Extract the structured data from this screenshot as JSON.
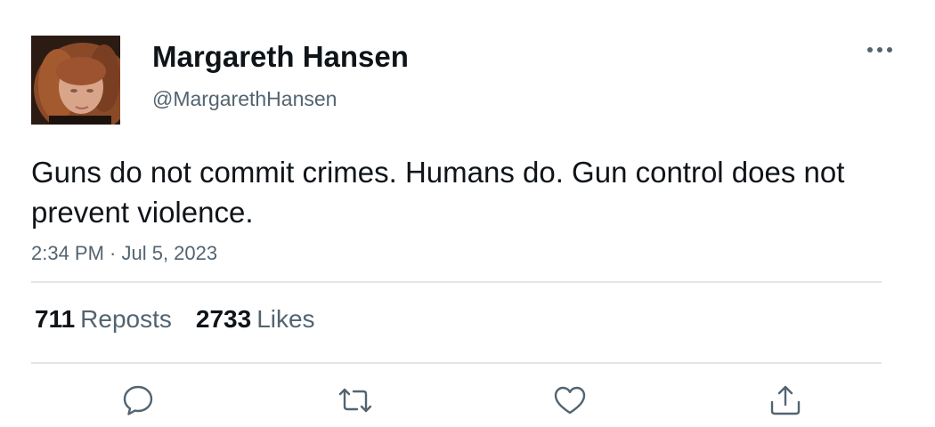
{
  "tweet": {
    "author": {
      "display_name": "Margareth Hansen",
      "handle": "@MargarethHansen"
    },
    "text": "Guns do not commit crimes. Humans do. Gun control does not prevent violence.",
    "timestamp": "2:34 PM · Jul 5, 2023",
    "stats": {
      "reposts_count": "711",
      "reposts_label": "Reposts",
      "likes_count": "2733",
      "likes_label": "Likes"
    }
  },
  "icons": {
    "more": "more-horizontal-icon",
    "reply": "reply-icon",
    "repost": "repost-icon",
    "like": "heart-icon",
    "share": "share-icon"
  },
  "colors": {
    "text_primary": "#0f1419",
    "text_secondary": "#536471",
    "divider": "#e1e6ea",
    "icon": "#536471"
  }
}
